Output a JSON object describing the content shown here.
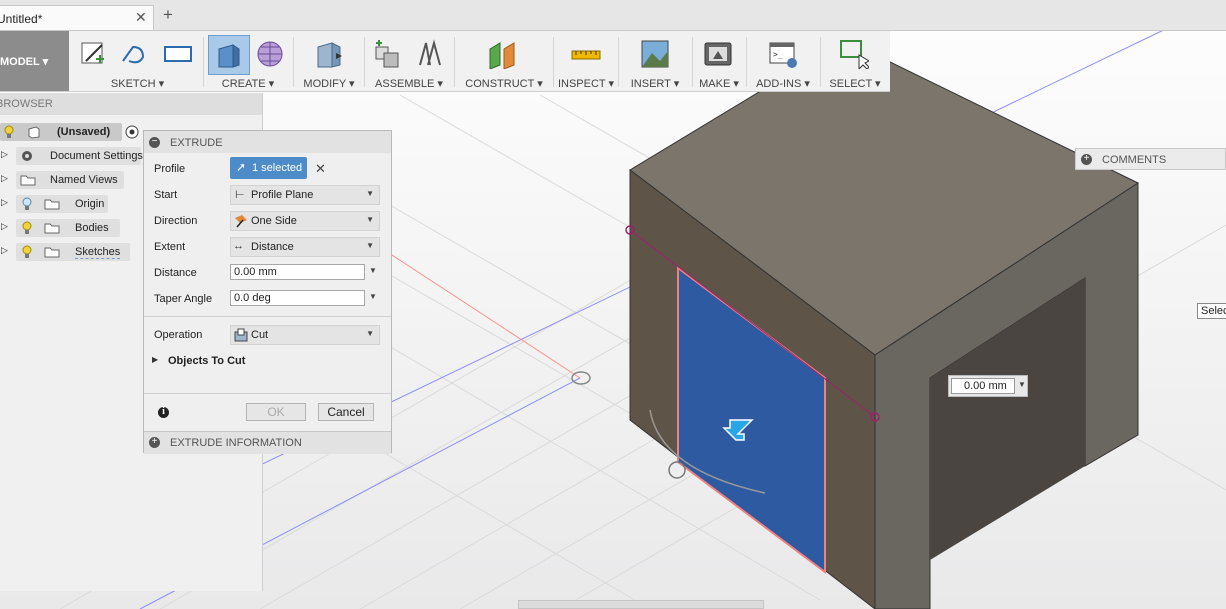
{
  "tab": {
    "title": "Untitled*",
    "close": "✕",
    "new": "+"
  },
  "toolbar": {
    "model": "MODEL ▾",
    "groups": [
      {
        "label": "SKETCH ▾"
      },
      {
        "label": "CREATE ▾"
      },
      {
        "label": "MODIFY ▾"
      },
      {
        "label": "ASSEMBLE ▾"
      },
      {
        "label": "CONSTRUCT ▾"
      },
      {
        "label": "INSPECT ▾"
      },
      {
        "label": "INSERT ▾"
      },
      {
        "label": "MAKE ▾"
      },
      {
        "label": "ADD-INS ▾"
      },
      {
        "label": "SELECT ▾"
      }
    ]
  },
  "browser": {
    "title": "BROWSER",
    "root": "(Unsaved)",
    "items": [
      {
        "label": "Document Settings",
        "icon": "gear-icon"
      },
      {
        "label": "Named Views",
        "icon": "folder-icon"
      },
      {
        "label": "Origin",
        "icon": "folder-icon"
      },
      {
        "label": "Bodies",
        "icon": "folder-icon"
      },
      {
        "label": "Sketches",
        "icon": "folder-icon"
      }
    ]
  },
  "extrude": {
    "title": "EXTRUDE",
    "profile_label": "Profile",
    "profile_value": "1 selected",
    "clear": "✕",
    "start_label": "Start",
    "start_value": "Profile Plane",
    "direction_label": "Direction",
    "direction_value": "One Side",
    "extent_label": "Extent",
    "extent_value": "Distance",
    "distance_label": "Distance",
    "distance_value": "0.00 mm",
    "taper_label": "Taper Angle",
    "taper_value": "0.0 deg",
    "operation_label": "Operation",
    "operation_value": "Cut",
    "objects_to_cut": "Objects To Cut",
    "ok": "OK",
    "cancel": "Cancel",
    "info_footer": "EXTRUDE INFORMATION"
  },
  "comments": {
    "label": "COMMENTS"
  },
  "canvas": {
    "dimension_value": "0.00 mm",
    "select_tip": "Select"
  },
  "colors": {
    "profile_fill": "#2d5aa0",
    "body_top": "#7b756c",
    "body_front": "#5e5447",
    "body_right": "#6a6660",
    "model_button": "#8c8c8c",
    "selected_button": "#4d8cc8"
  }
}
